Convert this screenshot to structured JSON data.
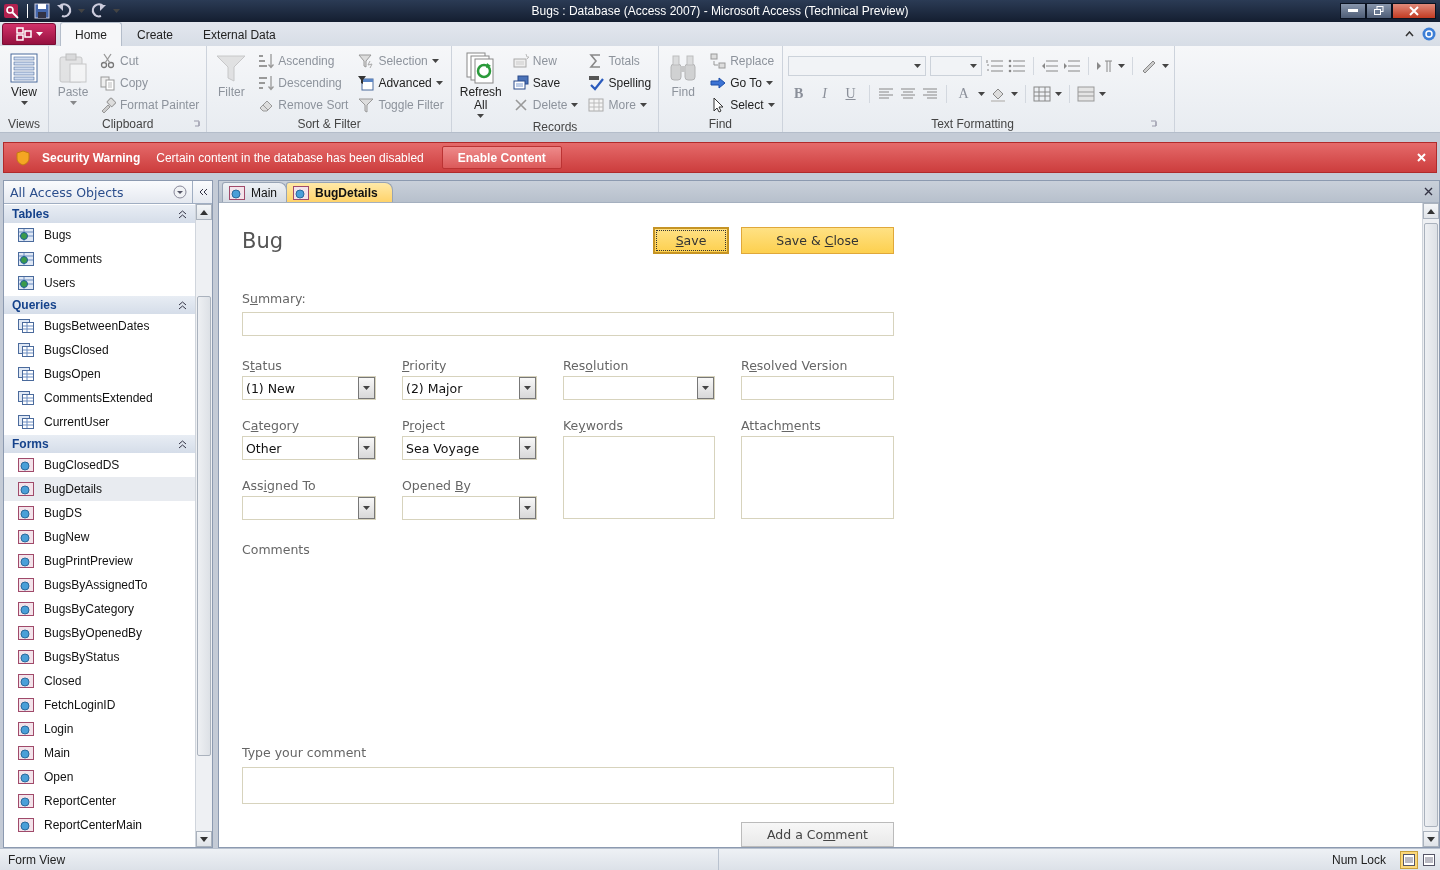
{
  "window": {
    "title": "Bugs : Database (Access 2007) - Microsoft Access (Technical Preview)"
  },
  "ribbon": {
    "tabs": [
      {
        "label": "Home",
        "selected": true
      },
      {
        "label": "Create",
        "selected": false
      },
      {
        "label": "External Data",
        "selected": false
      }
    ],
    "groups": [
      {
        "label": "Views",
        "launcher": false,
        "columns": [
          [
            {
              "kind": "large",
              "label": "View",
              "dropdown": true,
              "disabled": false
            }
          ]
        ]
      },
      {
        "label": "Clipboard",
        "launcher": true,
        "columns": [
          [
            {
              "kind": "large",
              "label": "Paste",
              "dropdown": true,
              "disabled": true
            }
          ],
          [
            {
              "kind": "small",
              "label": "Cut",
              "dropdown": false,
              "disabled": true
            },
            {
              "kind": "small",
              "label": "Copy",
              "dropdown": false,
              "disabled": true
            },
            {
              "kind": "small",
              "label": "Format Painter",
              "dropdown": false,
              "disabled": true
            }
          ]
        ]
      },
      {
        "label": "Sort & Filter",
        "launcher": false,
        "columns": [
          [
            {
              "kind": "large",
              "label": "Filter",
              "dropdown": false,
              "disabled": true
            }
          ],
          [
            {
              "kind": "small",
              "label": "Ascending",
              "dropdown": false,
              "disabled": true
            },
            {
              "kind": "small",
              "label": "Descending",
              "dropdown": false,
              "disabled": true
            },
            {
              "kind": "small",
              "label": "Remove Sort",
              "dropdown": false,
              "disabled": true
            }
          ],
          [
            {
              "kind": "small",
              "label": "Selection",
              "dropdown": true,
              "disabled": true
            },
            {
              "kind": "small",
              "label": "Advanced",
              "dropdown": true,
              "disabled": false
            },
            {
              "kind": "small",
              "label": "Toggle Filter",
              "dropdown": false,
              "disabled": true
            }
          ]
        ]
      },
      {
        "label": "Records",
        "launcher": false,
        "columns": [
          [
            {
              "kind": "large",
              "label": "Refresh All",
              "dropdown": true,
              "disabled": false
            }
          ],
          [
            {
              "kind": "small",
              "label": "New",
              "dropdown": false,
              "disabled": true
            },
            {
              "kind": "small",
              "label": "Save",
              "dropdown": false,
              "disabled": false
            },
            {
              "kind": "small",
              "label": "Delete",
              "dropdown": true,
              "disabled": true
            }
          ],
          [
            {
              "kind": "small",
              "label": "Totals",
              "dropdown": false,
              "disabled": true
            },
            {
              "kind": "small",
              "label": "Spelling",
              "dropdown": false,
              "disabled": false
            },
            {
              "kind": "small",
              "label": "More",
              "dropdown": true,
              "disabled": true
            }
          ]
        ]
      },
      {
        "label": "Find",
        "launcher": false,
        "columns": [
          [
            {
              "kind": "large",
              "label": "Find",
              "dropdown": false,
              "disabled": true
            }
          ],
          [
            {
              "kind": "small",
              "label": "Replace",
              "dropdown": false,
              "disabled": true
            },
            {
              "kind": "small",
              "label": "Go To",
              "dropdown": true,
              "disabled": false
            },
            {
              "kind": "small",
              "label": "Select",
              "dropdown": true,
              "disabled": false
            }
          ]
        ]
      },
      {
        "label": "Text Formatting",
        "launcher": true,
        "kind": "formatting",
        "style_buttons": [
          "B",
          "I",
          "U"
        ],
        "font_color": "A"
      }
    ]
  },
  "security_bar": {
    "title": "Security Warning",
    "message": "Certain content in the database has been disabled",
    "button": "Enable Content"
  },
  "navigation": {
    "title": "All Access Objects",
    "groups": [
      {
        "label": "Tables",
        "items": [
          {
            "label": "Bugs",
            "kind": "table",
            "selected": false
          },
          {
            "label": "Comments",
            "kind": "table",
            "selected": false
          },
          {
            "label": "Users",
            "kind": "table",
            "selected": false
          }
        ]
      },
      {
        "label": "Queries",
        "items": [
          {
            "label": "BugsBetweenDates",
            "kind": "query",
            "selected": false
          },
          {
            "label": "BugsClosed",
            "kind": "query",
            "selected": false
          },
          {
            "label": "BugsOpen",
            "kind": "query",
            "selected": false
          },
          {
            "label": "CommentsExtended",
            "kind": "query",
            "selected": false
          },
          {
            "label": "CurrentUser",
            "kind": "query",
            "selected": false
          }
        ]
      },
      {
        "label": "Forms",
        "items": [
          {
            "label": "BugClosedDS",
            "kind": "form",
            "selected": false
          },
          {
            "label": "BugDetails",
            "kind": "form",
            "selected": true
          },
          {
            "label": "BugDS",
            "kind": "form",
            "selected": false
          },
          {
            "label": "BugNew",
            "kind": "form",
            "selected": false
          },
          {
            "label": "BugPrintPreview",
            "kind": "form",
            "selected": false
          },
          {
            "label": "BugsByAssignedTo",
            "kind": "form",
            "selected": false
          },
          {
            "label": "BugsByCategory",
            "kind": "form",
            "selected": false
          },
          {
            "label": "BugsByOpenedBy",
            "kind": "form",
            "selected": false
          },
          {
            "label": "BugsByStatus",
            "kind": "form",
            "selected": false
          },
          {
            "label": "Closed",
            "kind": "form",
            "selected": false
          },
          {
            "label": "FetchLoginID",
            "kind": "form",
            "selected": false
          },
          {
            "label": "Login",
            "kind": "form",
            "selected": false
          },
          {
            "label": "Main",
            "kind": "form",
            "selected": false
          },
          {
            "label": "Open",
            "kind": "form",
            "selected": false
          },
          {
            "label": "ReportCenter",
            "kind": "form",
            "selected": false
          },
          {
            "label": "ReportCenterMain",
            "kind": "form",
            "selected": false
          }
        ]
      }
    ]
  },
  "document_tabs": [
    {
      "label": "Main",
      "selected": false
    },
    {
      "label": "BugDetails",
      "selected": true
    }
  ],
  "form": {
    "title": "Bug",
    "buttons": [
      {
        "key": "S",
        "post": "ave",
        "focused": true
      },
      {
        "pre": "Save & ",
        "key": "C",
        "post": "lose",
        "focused": false
      }
    ],
    "summary": {
      "label": {
        "pre": "S",
        "key": "u",
        "post": "mmary:"
      }
    },
    "fields": [
      {
        "kind": "combo",
        "label": {
          "pre": "S",
          "key": "t",
          "post": "atus"
        },
        "value": "(1) New"
      },
      {
        "kind": "combo",
        "label": {
          "key": "P",
          "post": "riority"
        },
        "value": "(2) Major"
      },
      {
        "kind": "combo",
        "label": {
          "pre": "Res",
          "key": "o",
          "post": "lution"
        }
      },
      {
        "kind": "text",
        "label": {
          "pre": "R",
          "key": "e",
          "post": "solved Version"
        }
      },
      {
        "kind": "combo",
        "label": {
          "pre": "C",
          "key": "a",
          "post": "tegory"
        },
        "value": "Other"
      },
      {
        "kind": "combo",
        "label": {
          "pre": "P",
          "key": "r",
          "post": "oject"
        },
        "value": "Sea Voyage"
      },
      {
        "kind": "box",
        "label": {
          "pre": "Ke",
          "key": "y",
          "post": "words"
        }
      },
      {
        "kind": "box",
        "label": {
          "pre": "Attach",
          "key": "m",
          "post": "ents"
        }
      },
      {
        "kind": "combo",
        "label": {
          "pre": "Ass",
          "key": "i",
          "post": "gned To"
        }
      },
      {
        "kind": "combo",
        "label": {
          "pre": "Opened ",
          "key": "B",
          "post": "y"
        }
      }
    ],
    "comments_label": {
      "pre": "Comments"
    },
    "comment_field": {
      "label": {
        "pre": "Type your comment"
      }
    },
    "add_button": {
      "pre": "Add a Co",
      "key": "m",
      "post": "ment"
    }
  },
  "status_bar": {
    "left": "Form View",
    "right": "Num Lock",
    "views": [
      {
        "selected": true
      },
      {
        "selected": false
      }
    ]
  }
}
